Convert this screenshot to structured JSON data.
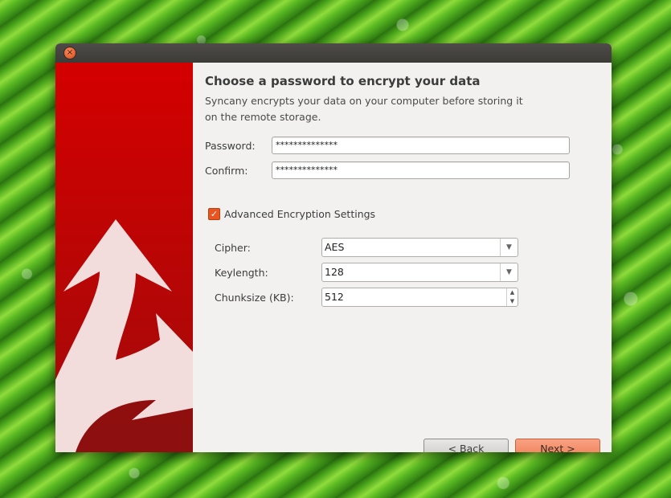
{
  "window": {
    "close_icon": "close-icon",
    "close_glyph": "×"
  },
  "sidebar": {
    "logo_icon": "syncany-arrows-icon"
  },
  "heading": "Choose a password to encrypt your data",
  "subtext_line1": "Syncany encrypts your data on your computer before storing it",
  "subtext_line2": "on the remote storage.",
  "password": {
    "label": "Password:",
    "value": "**************"
  },
  "confirm": {
    "label": "Confirm:",
    "value": "**************"
  },
  "advanced": {
    "label": "Advanced Encryption Settings",
    "checked": true,
    "check_glyph": "✓"
  },
  "cipher": {
    "label": "Cipher:",
    "value": "AES"
  },
  "keylength": {
    "label": "Keylength:",
    "value": "128"
  },
  "chunksize": {
    "label": "Chunksize (KB):",
    "value": "512"
  },
  "buttons": {
    "back": "< Back",
    "next": "Next >"
  },
  "colors": {
    "accent": "#e95420",
    "sidebar": "#c40000",
    "next_button": "#f08a63"
  }
}
